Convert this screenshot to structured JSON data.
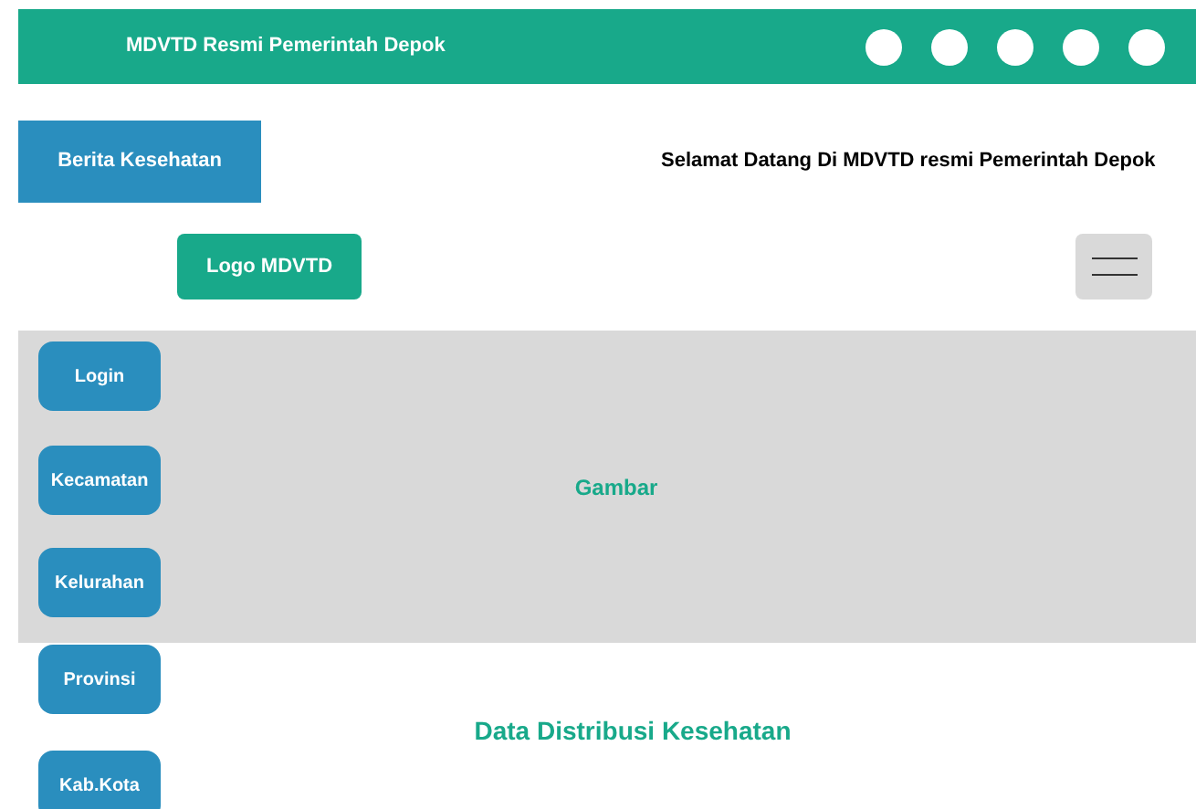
{
  "header": {
    "title": "MDVTD Resmi Pemerintah Depok"
  },
  "news_button": "Berita Kesehatan",
  "welcome": "Selamat Datang Di MDVTD resmi Pemerintah Depok",
  "logo_button": "Logo MDVTD",
  "side_menu": [
    {
      "label": "Login"
    },
    {
      "label": "Kecamatan"
    },
    {
      "label": "Kelurahan"
    },
    {
      "label": "Provinsi"
    },
    {
      "label": "Kab.Kota"
    }
  ],
  "banner": {
    "label": "Gambar"
  },
  "section_title": "Data Distribusi Kesehatan"
}
